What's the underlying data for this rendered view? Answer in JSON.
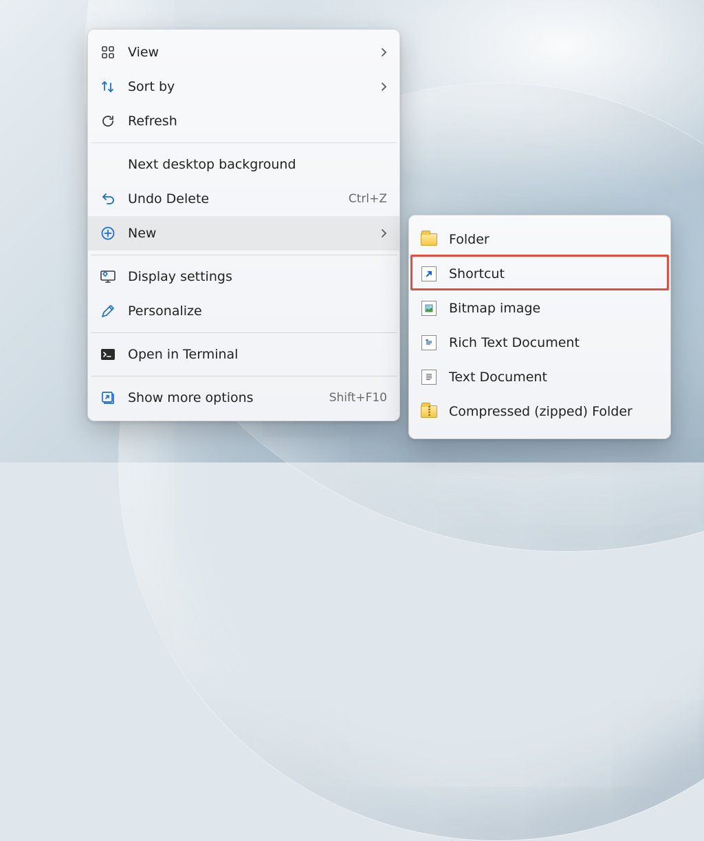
{
  "contextMenu": {
    "view": "View",
    "sortBy": "Sort by",
    "refresh": "Refresh",
    "nextBackground": "Next desktop background",
    "undoDelete": "Undo Delete",
    "undoDelete_accel": "Ctrl+Z",
    "new": "New",
    "displaySettings": "Display settings",
    "personalize": "Personalize",
    "openTerminal": "Open in Terminal",
    "showMore": "Show more options",
    "showMore_accel": "Shift+F10"
  },
  "newSubmenu": {
    "folder": "Folder",
    "shortcut": "Shortcut",
    "bitmap": "Bitmap image",
    "rtf": "Rich Text Document",
    "txt": "Text Document",
    "zip": "Compressed (zipped) Folder"
  },
  "highlight": {
    "target": "shortcut"
  }
}
